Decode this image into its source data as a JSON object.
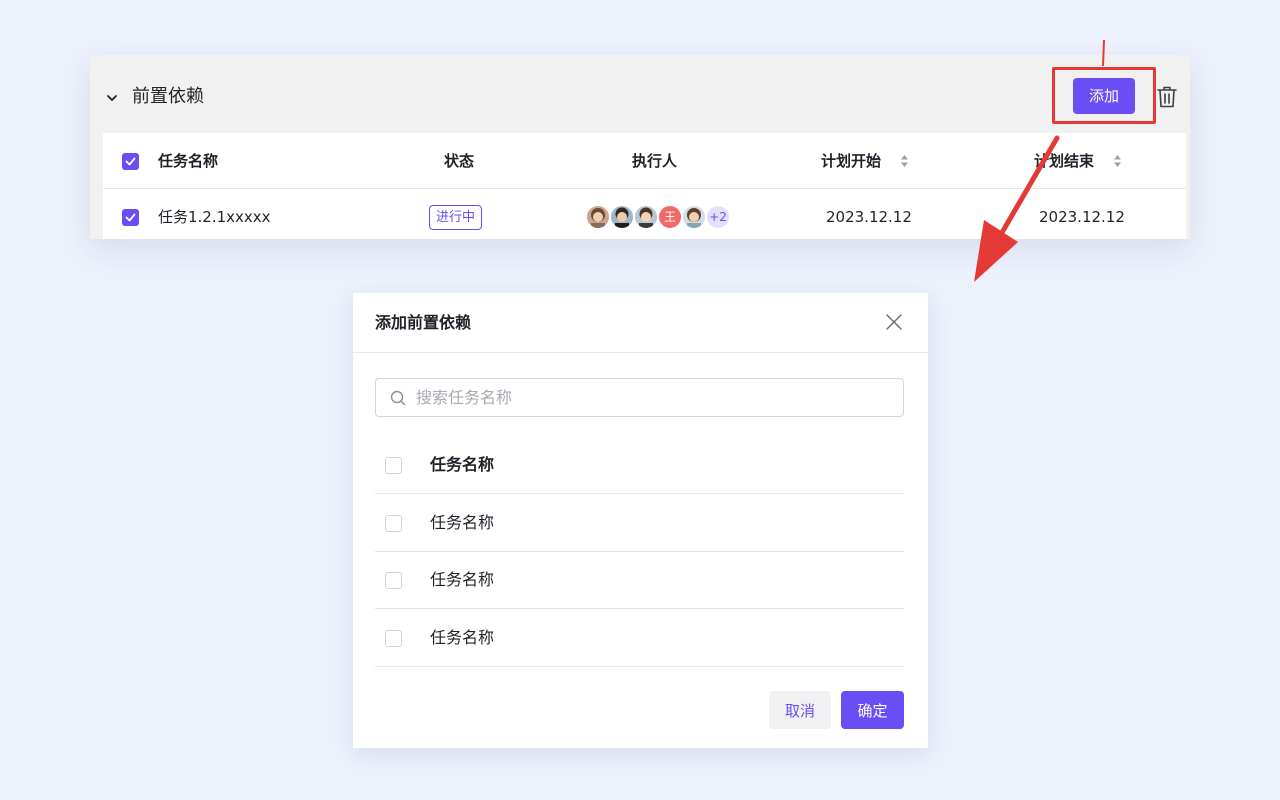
{
  "section": {
    "title": "前置依赖",
    "add_label": "添加"
  },
  "table": {
    "headers": {
      "name": "任务名称",
      "status": "状态",
      "assignee": "执行人",
      "plan_start": "计划开始",
      "plan_end": "计划结束"
    },
    "rows": [
      {
        "name": "任务1.2.1xxxxx",
        "status": "进行中",
        "assignees": [
          "avatar-1",
          "avatar-2",
          "avatar-3",
          "王",
          "avatar-5"
        ],
        "more_count": "+2",
        "plan_start": "2023.12.12",
        "plan_end": "2023.12.12"
      }
    ]
  },
  "dialog": {
    "title": "添加前置依赖",
    "search_placeholder": "搜索任务名称",
    "list_header": "任务名称",
    "items": [
      "任务名称",
      "任务名称",
      "任务名称"
    ],
    "cancel_label": "取消",
    "confirm_label": "确定"
  },
  "colors": {
    "primary": "#6a4df5",
    "annotation": "#e53935",
    "background": "#ecf1fc"
  }
}
